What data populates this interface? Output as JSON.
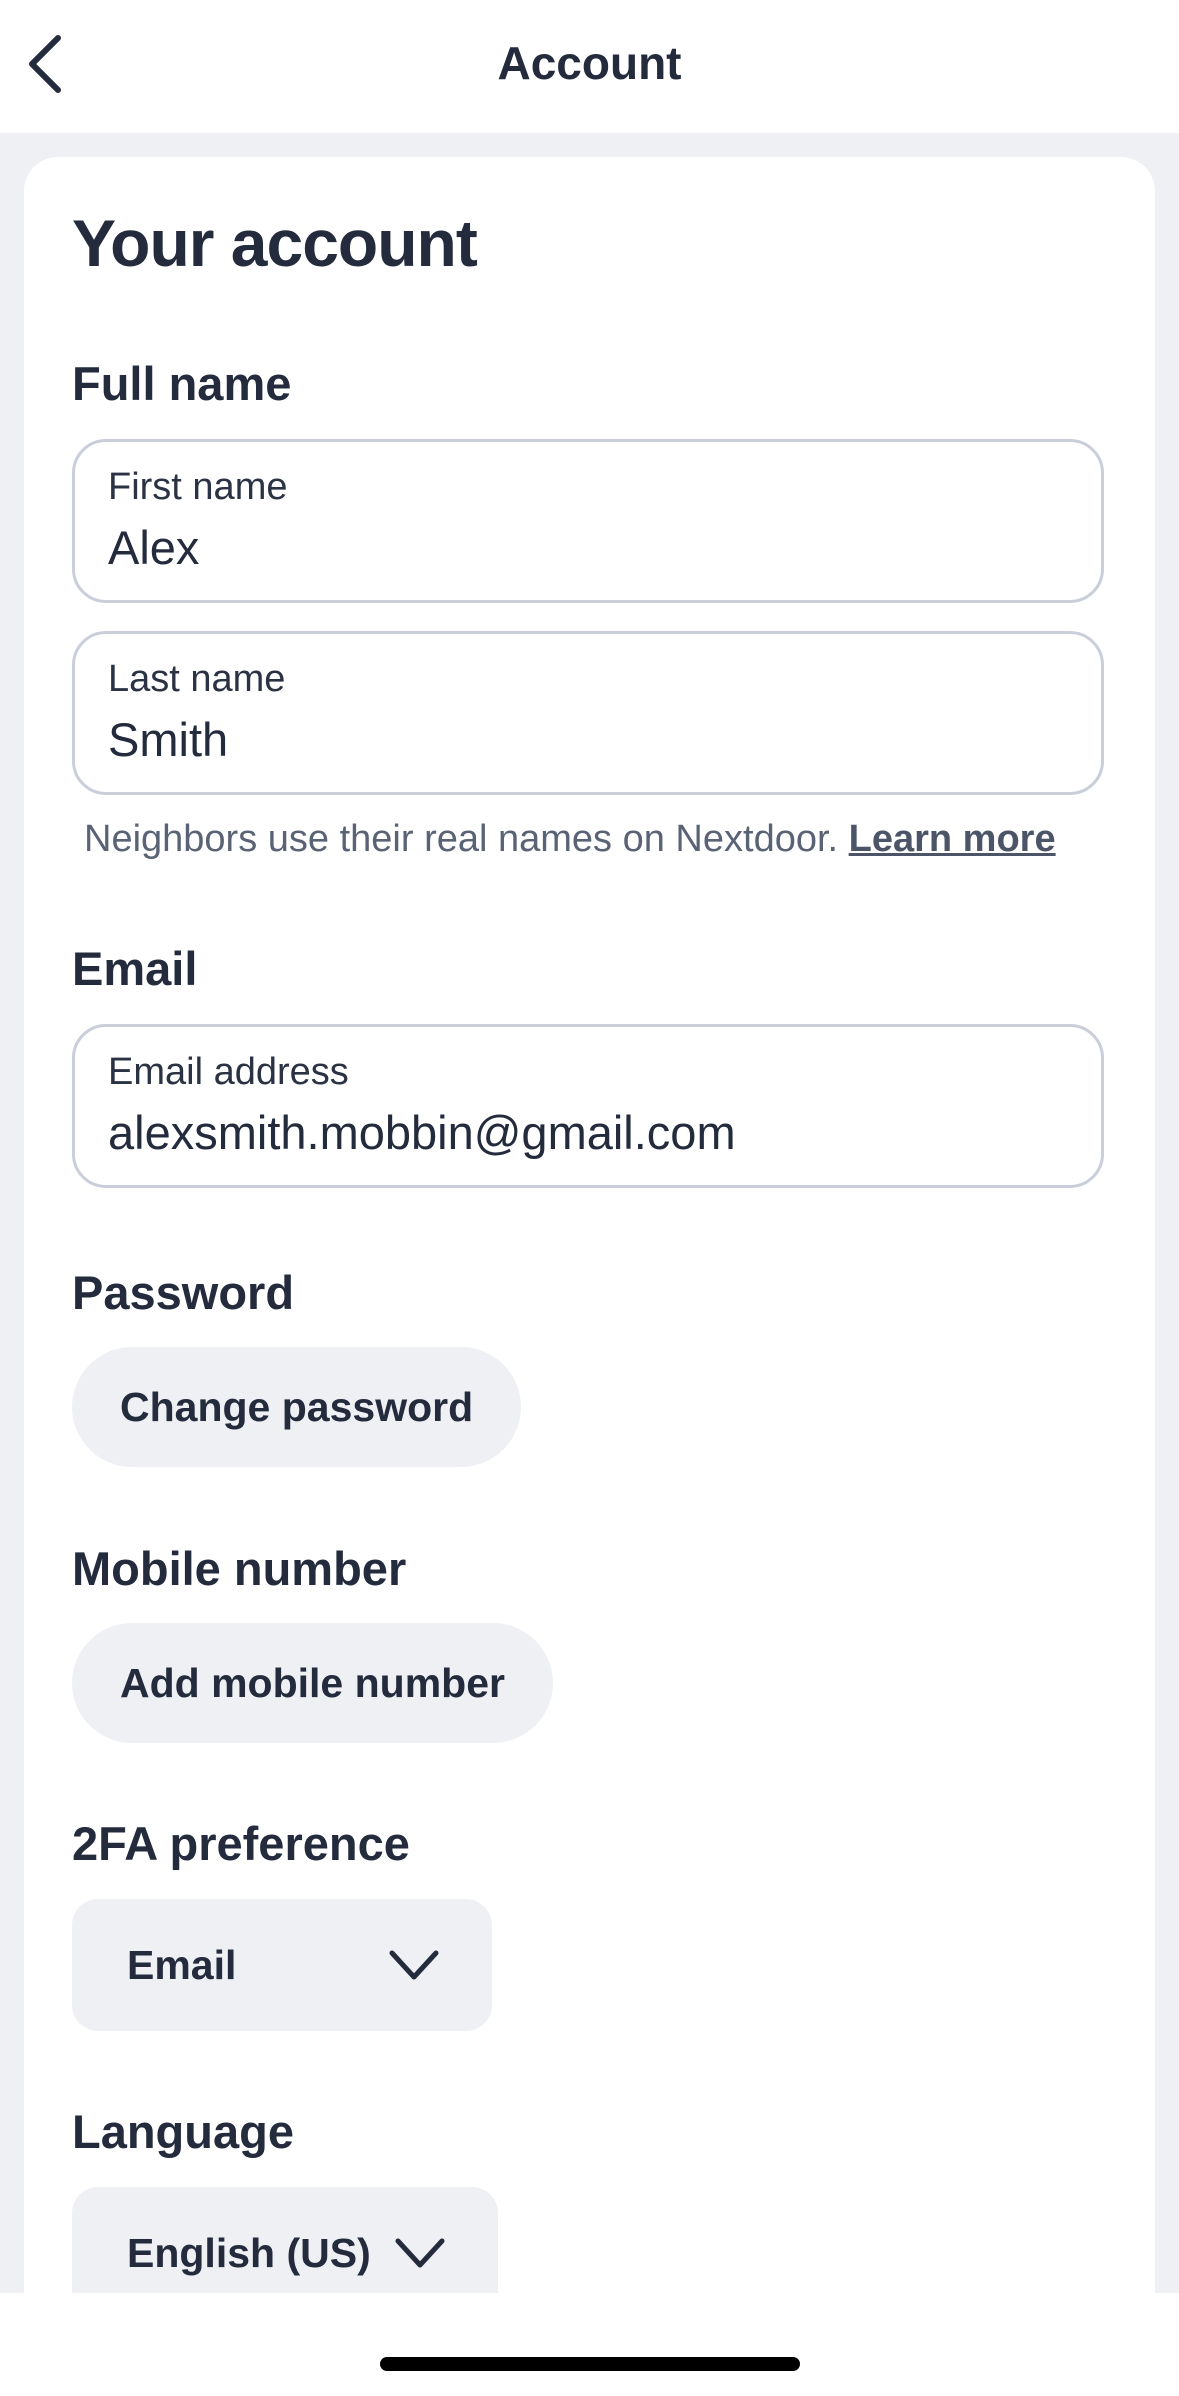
{
  "header": {
    "title": "Account"
  },
  "card": {
    "title": "Your account"
  },
  "full_name": {
    "label": "Full name",
    "first": {
      "label": "First name",
      "value": "Alex"
    },
    "last": {
      "label": "Last name",
      "value": "Smith"
    },
    "helper_text": "Neighbors use their real names on Nextdoor. ",
    "helper_link": "Learn more"
  },
  "email": {
    "label": "Email",
    "field_label": "Email address",
    "value": "alexsmith.mobbin@gmail.com"
  },
  "password": {
    "label": "Password",
    "button": "Change password"
  },
  "mobile": {
    "label": "Mobile number",
    "button": "Add mobile number"
  },
  "twofa": {
    "label": "2FA preference",
    "selected": "Email"
  },
  "language": {
    "label": "Language",
    "selected": "English (US)"
  },
  "icons": {
    "back": "chevron-left-icon",
    "dropdown": "chevron-down-icon"
  },
  "colors": {
    "text": "#232b3d",
    "background_grey": "#eef0f4",
    "field_border": "#c9ceda"
  }
}
